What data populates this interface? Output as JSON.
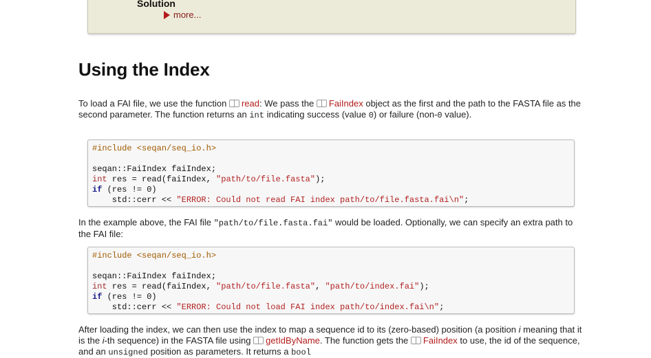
{
  "solution": {
    "title": "Solution",
    "more": "more..."
  },
  "heading": "Using the Index",
  "p1": {
    "t1": "To load a FAI file, we use the function ",
    "link_read": "read",
    "t2": ": We pass the ",
    "link_faiindex": "FaiIndex",
    "t3": " object as the first and the path to the FASTA file as the second parameter. The function returns an ",
    "code_int": "int",
    "t4": " indicating success (value ",
    "code_0": "0",
    "t5": ") or failure (non-",
    "code_0b": "0",
    "t6": " value)."
  },
  "code1": {
    "line1": "#include <seqan/seq_io.h>",
    "line3": "seqan::FaiIndex faiIndex;",
    "line4_kw": "int",
    "line4_rest": " res = read(faiIndex, ",
    "line4_str": "\"path/to/file.fasta\"",
    "line4_end": ");",
    "line5_kw": "if",
    "line5_rest": " (res != 0)",
    "line6_a": "    std::cerr << ",
    "line6_str": "\"ERROR: Could not read FAI index path/to/file.fasta.fai\\n\"",
    "line6_end": ";"
  },
  "p2": {
    "t1": "In the example above, the FAI file ",
    "code_path": "\"path/to/file.fasta.fai\"",
    "t2": " would be loaded. Optionally, we can specify an extra path to the FAI file:"
  },
  "code2": {
    "line1": "#include <seqan/seq_io.h>",
    "line3": "seqan::FaiIndex faiIndex;",
    "line4_kw": "int",
    "line4_rest": " res = read(faiIndex, ",
    "line4_str1": "\"path/to/file.fasta\"",
    "line4_mid": ", ",
    "line4_str2": "\"path/to/index.fai\"",
    "line4_end": ");",
    "line5_kw": "if",
    "line5_rest": " (res != 0)",
    "line6_a": "    std::cerr << ",
    "line6_str": "\"ERROR: Could not load FAI index path/to/index.fai\\n\"",
    "line6_end": ";"
  },
  "p3": {
    "t1": "After loading the index, we can then use the index to map a sequence id to its (zero-based) position (a position ",
    "i1": "i",
    "t2": " meaning that it is the ",
    "i2": "i",
    "t3": "-th sequence) in the FASTA file using ",
    "link_getidbyname": "getIdByName",
    "t4": ". The function gets the ",
    "link_faiindex": "FaiIndex",
    "t5": " to use, the id of the sequence, and an ",
    "code_unsigned": "unsigned",
    "t6": " position as parameters. It returns a ",
    "code_bool": "bool"
  },
  "colors": {
    "link": "#b31b1b",
    "solution_bg": "#ecebd9",
    "code_bg": "#f7f7f7"
  }
}
